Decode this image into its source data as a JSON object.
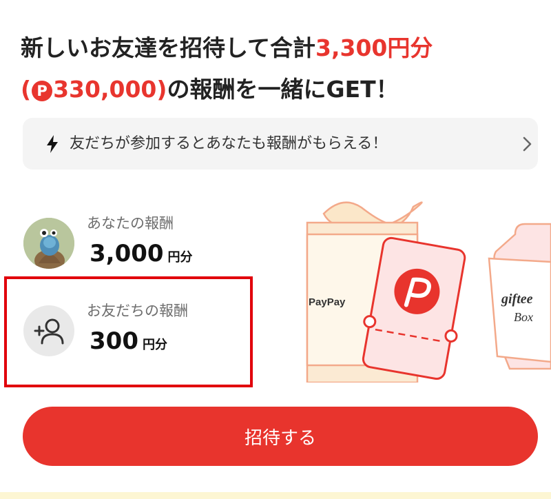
{
  "headline": {
    "line1_text": "新しいお友達を招待して合計",
    "line1_highlight": "3,300円分",
    "line2_open": "(",
    "points_badge": "P",
    "line2_points": "330,000)",
    "line2_text": "の報酬を一緒にGET！"
  },
  "notice": {
    "icon": "lightning-icon",
    "text": "友だちが参加するとあなたも報酬がもらえる！",
    "chevron_icon": "chevron-right-icon"
  },
  "rewards": {
    "you": {
      "label": "あなたの報酬",
      "amount": "3,000",
      "unit": "円分",
      "icon": "user-avatar"
    },
    "friend": {
      "label": "お友だちの報酬",
      "amount": "300",
      "unit": "円分",
      "icon": "add-person-icon"
    }
  },
  "illustration": {
    "paypay_text": "PayPay",
    "giftee_text": "giftee",
    "giftee_box": "Box"
  },
  "cta": {
    "label": "招待する"
  },
  "colors": {
    "accent": "#e8342d",
    "highlight_box": "#e1000b"
  }
}
